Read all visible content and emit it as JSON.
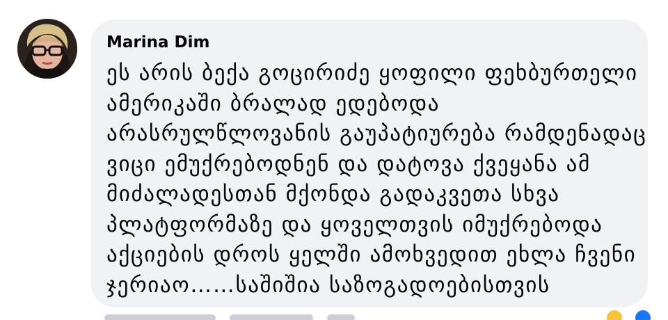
{
  "comment": {
    "author": "Marina Dim",
    "avatar_icon": "avatar",
    "lines": [
      "ეს არის ბექა გოცირიძე ყოფილი ფეხბურთელი",
      "ამერიკაში ბრალად ედებოდა",
      "არასრულწლოვანის გაუპატიურება რამდენადაც",
      "ვიცი ემუქრებოდნენ და დატოვა ქვეყანა ამ",
      "მიძალადესთან მქონდა გადაკვეთა სხვა",
      "პლატფორმაზე და ყოველთვის იმუქრებოდა",
      "აქციების დროს ყელში ამოხვედით ეხლა ჩვენი",
      "ჯერიაო……საშიშია საზოგადოებისთვის"
    ]
  },
  "reactions": {
    "icons": [
      "haha-icon",
      "like-icon"
    ]
  },
  "colors": {
    "bubble": "#f0f2f5",
    "text": "#050505",
    "like": "#1877f2",
    "haha": "#f7c33c"
  }
}
